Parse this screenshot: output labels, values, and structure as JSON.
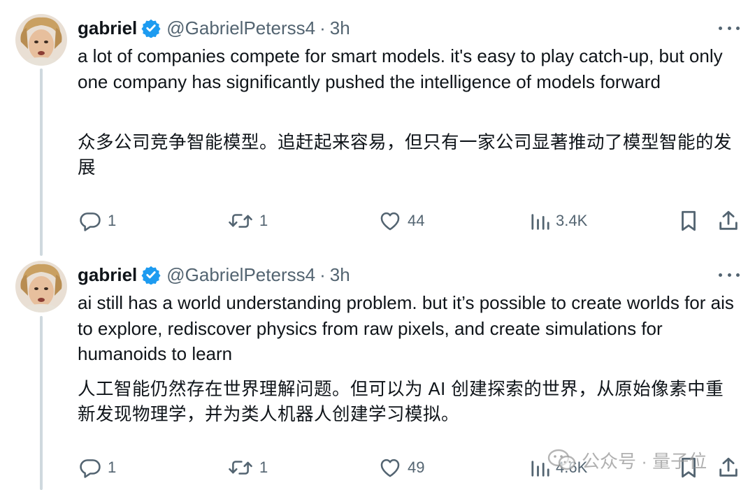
{
  "tweets": [
    {
      "author_name": "gabriel",
      "handle": "@GabrielPeterss4",
      "separator": "·",
      "time": "3h",
      "text_en": "a lot of companies compete for smart models. it's easy to play catch-up, but only one company has significantly pushed the intelligence of models forward",
      "text_zh": "众多公司竞争智能模型。追赶起来容易，但只有一家公司显著推动了模型智能的发展",
      "replies": "1",
      "retweets": "1",
      "likes": "44",
      "views": "3.4K"
    },
    {
      "author_name": "gabriel",
      "handle": "@GabrielPeterss4",
      "separator": "·",
      "time": "3h",
      "text_en": "ai still has a world understanding problem. but it’s possible to create worlds for ais to explore, rediscover physics from raw pixels, and create simulations for humanoids to learn",
      "text_zh": "人工智能仍然存在世界理解问题。但可以为 AI 创建探索的世界，从原始像素中重新发现物理学，并为类人机器人创建学习模拟。",
      "replies": "1",
      "retweets": "1",
      "likes": "49",
      "views": "4.6K"
    }
  ],
  "icons": {
    "verified": "verified-badge-icon",
    "more": "more-icon",
    "reply": "reply-icon",
    "retweet": "retweet-icon",
    "like": "heart-icon",
    "views": "views-icon",
    "bookmark": "bookmark-icon",
    "share": "share-icon"
  },
  "colors": {
    "verified_blue": "#1d9bf0",
    "secondary_text": "#536471",
    "primary_text": "#0f1419",
    "thread_line": "#cfd9de"
  },
  "watermark": {
    "text": "公众号 · 量子位"
  }
}
